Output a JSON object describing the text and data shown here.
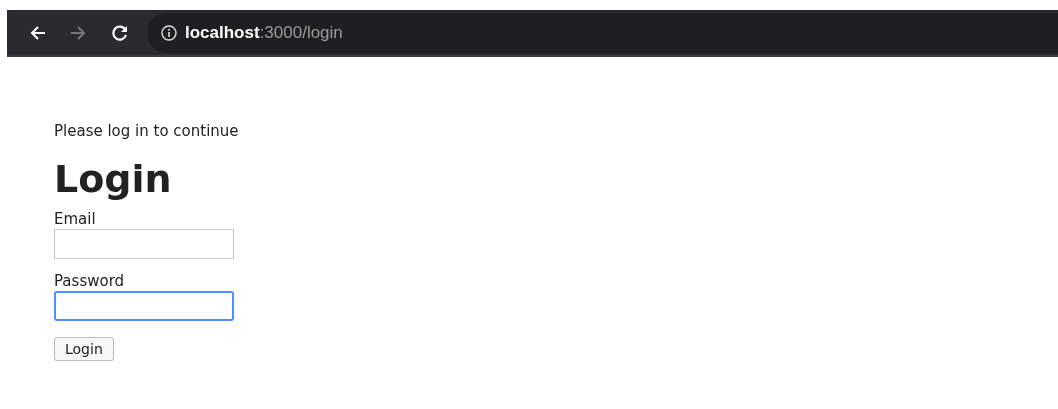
{
  "browser": {
    "back_enabled": true,
    "forward_enabled": false,
    "url_host": "localhost",
    "url_path": ":3000/login"
  },
  "page": {
    "notice": "Please log in to continue",
    "heading": "Login",
    "fields": [
      {
        "label": "Email",
        "focused": false
      },
      {
        "label": "Password",
        "focused": true
      }
    ],
    "button": "Login"
  }
}
